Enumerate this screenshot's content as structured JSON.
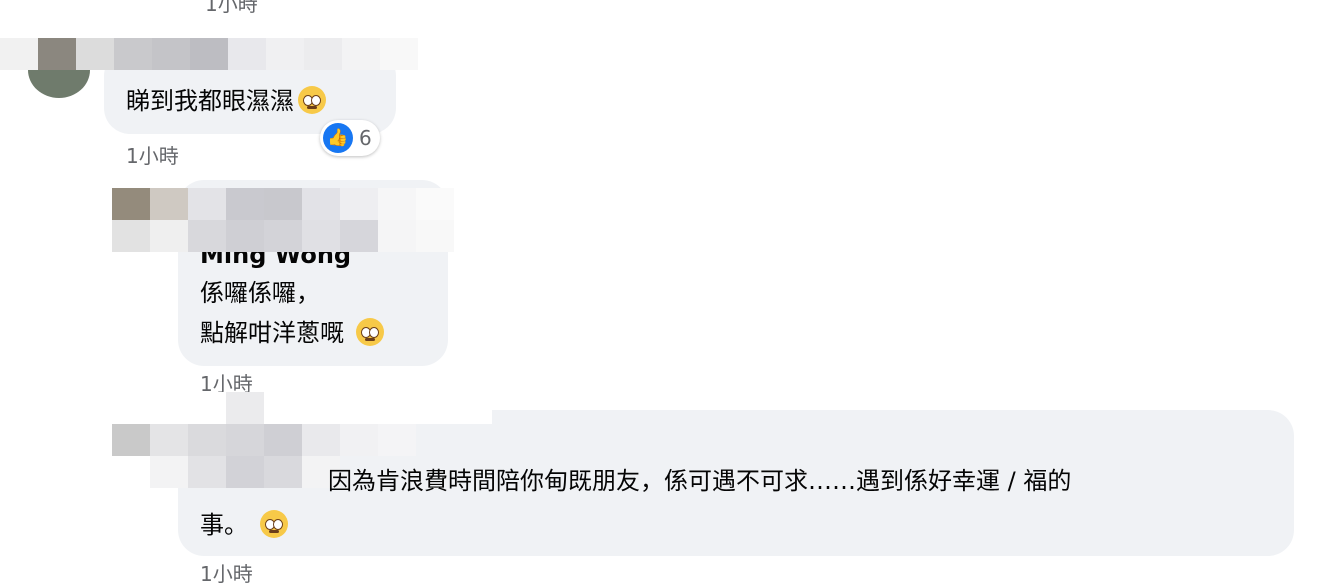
{
  "comments": [
    {
      "text": "睇到我都眼濕濕",
      "reaction": {
        "icon": "like-icon",
        "count": "6"
      },
      "timestamp": "1小時"
    },
    {
      "name": "Ming Wong",
      "lines": [
        "係囉係囉，",
        "點解咁洋蔥嘅"
      ],
      "timestamp": "1小時"
    },
    {
      "line1": "因為肯浪費時間陪你甸既朋友，係可遇不可求……遇到係好幸運 / 福的",
      "line2": "事。",
      "timestamp": "1小時"
    }
  ],
  "top_timestamp": "1小時",
  "colors": {
    "bubble": "#f0f2f5",
    "timestamp": "#65676b",
    "like": "#1877f2"
  }
}
